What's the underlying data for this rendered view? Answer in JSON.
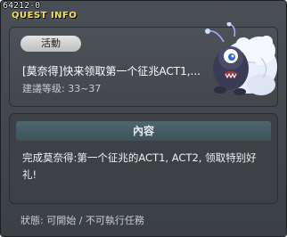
{
  "window": {
    "id": "64212-0",
    "title": "QUEST INFO"
  },
  "quest": {
    "category": "活動",
    "name": "[莫奈得]快来领取第一个征兆ACT1,...",
    "level": "建議等级: 33~37",
    "npc_icon": "ghost-bear-npc-icon"
  },
  "content": {
    "header": "內容",
    "text": "完成莫奈得:第一个征兆的ACT1, ACT2, 领取特别好礼!"
  },
  "status": {
    "text": "狀態: 可開始 / 不可執行任務"
  }
}
